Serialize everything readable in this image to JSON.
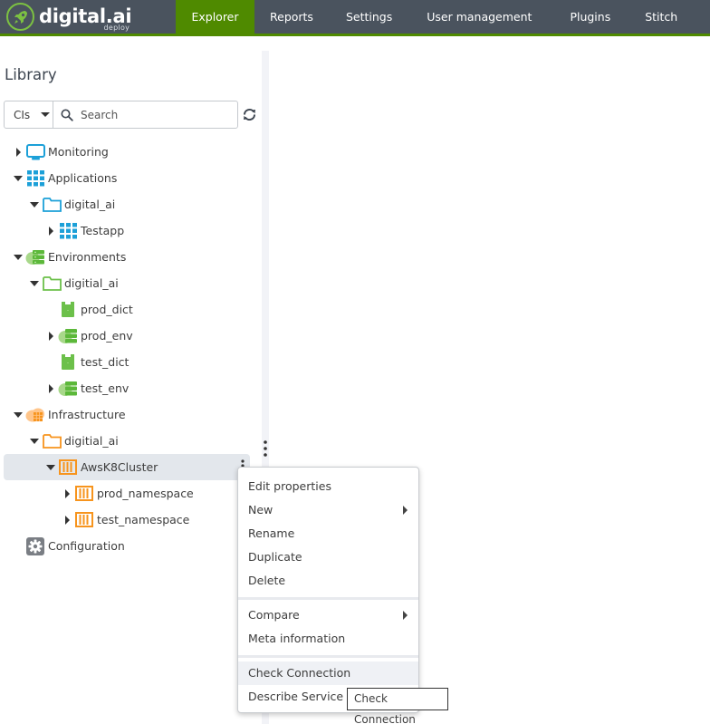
{
  "brand": {
    "name": "digital.ai",
    "product": "deploy",
    "logo_icon": "rocket-icon",
    "accent_color": "#4f8a00",
    "logo_color": "#7cc142",
    "topbar_color": "#4a535e"
  },
  "nav": {
    "tabs": [
      {
        "label": "Explorer",
        "active": true
      },
      {
        "label": "Reports",
        "active": false
      },
      {
        "label": "Settings",
        "active": false
      },
      {
        "label": "User management",
        "active": false
      },
      {
        "label": "Plugins",
        "active": false
      },
      {
        "label": "Stitch",
        "active": false
      }
    ]
  },
  "library": {
    "title": "Library",
    "search_type": "CIs",
    "search_placeholder": "Search",
    "search_value": "",
    "refresh_icon": "refresh-icon"
  },
  "tree": [
    {
      "label": "Monitoring",
      "level": 0,
      "state": "collapsed",
      "icon": "monitor-icon"
    },
    {
      "label": "Applications",
      "level": 0,
      "state": "expanded",
      "icon": "applications-grid-icon"
    },
    {
      "label": "digital_ai",
      "level": 1,
      "state": "expanded",
      "icon": "folder-icon"
    },
    {
      "label": "Testapp",
      "level": 2,
      "state": "collapsed",
      "icon": "application-grid-icon"
    },
    {
      "label": "Environments",
      "level": 0,
      "state": "expanded",
      "icon": "environments-icon"
    },
    {
      "label": "digitial_ai",
      "level": 1,
      "state": "expanded",
      "icon": "folder-icon"
    },
    {
      "label": "prod_dict",
      "level": 2,
      "state": "leaf",
      "icon": "dictionary-icon"
    },
    {
      "label": "prod_env",
      "level": 2,
      "state": "collapsed",
      "icon": "environment-icon"
    },
    {
      "label": "test_dict",
      "level": 2,
      "state": "leaf",
      "icon": "dictionary-icon"
    },
    {
      "label": "test_env",
      "level": 2,
      "state": "collapsed",
      "icon": "environment-icon"
    },
    {
      "label": "Infrastructure",
      "level": 0,
      "state": "expanded",
      "icon": "infrastructure-icon"
    },
    {
      "label": "digitial_ai",
      "level": 1,
      "state": "expanded",
      "icon": "folder-icon"
    },
    {
      "label": "AwsK8Cluster",
      "level": 2,
      "state": "expanded",
      "icon": "k8s-cluster-icon",
      "selected": true
    },
    {
      "label": "prod_namespace",
      "level": 3,
      "state": "collapsed",
      "icon": "k8s-namespace-icon"
    },
    {
      "label": "test_namespace",
      "level": 3,
      "state": "collapsed",
      "icon": "k8s-namespace-icon"
    },
    {
      "label": "Configuration",
      "level": 0,
      "state": "leaf",
      "icon": "gear-icon"
    }
  ],
  "context_menu": {
    "items": [
      {
        "label": "Edit properties",
        "submenu": false
      },
      {
        "label": "New",
        "submenu": true
      },
      {
        "label": "Rename",
        "submenu": false
      },
      {
        "label": "Duplicate",
        "submenu": false
      },
      {
        "label": "Delete",
        "submenu": false
      },
      {
        "label": "Compare",
        "submenu": true
      },
      {
        "label": "Meta information",
        "submenu": false
      },
      {
        "label": "Check Connection",
        "submenu": false,
        "hovered": true
      },
      {
        "label": "Describe Service",
        "submenu": false
      }
    ]
  },
  "tooltip": {
    "text": "Check Connection"
  }
}
